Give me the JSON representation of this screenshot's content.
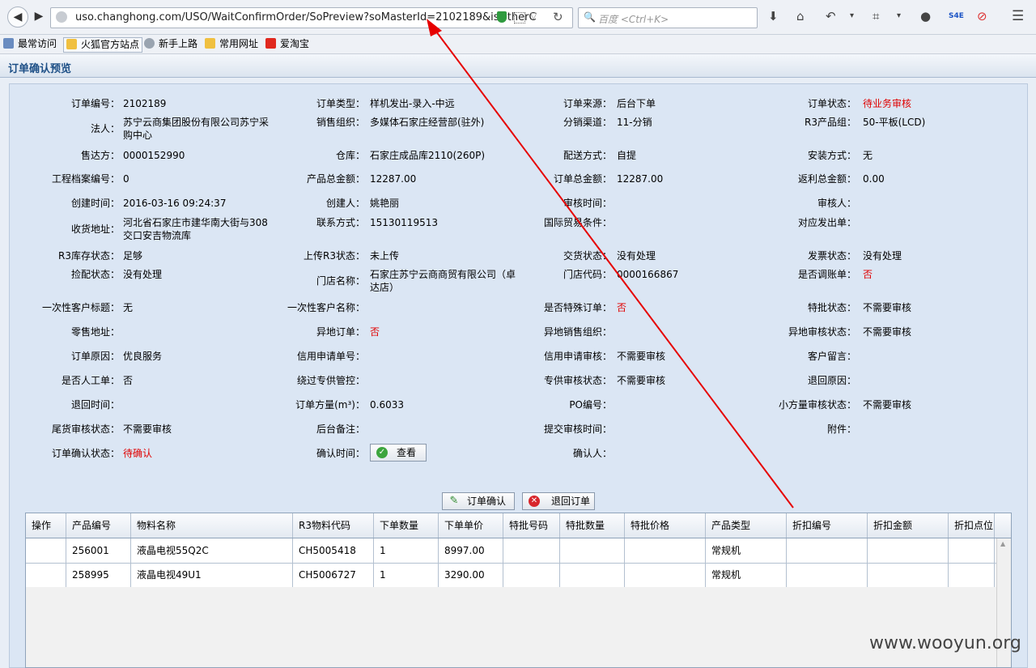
{
  "browser": {
    "url": "uso.changhong.com/USO/WaitConfirmOrder/SoPreview?soMasterId=2102189&isOtherC",
    "search_placeholder": "百度 <Ctrl+K>"
  },
  "bookmarks": [
    {
      "label": "最常访问"
    },
    {
      "label": "火狐官方站点"
    },
    {
      "label": "新手上路"
    },
    {
      "label": "常用网址"
    },
    {
      "label": "爱淘宝"
    }
  ],
  "page": {
    "title": "订单确认预览"
  },
  "fields": [
    {
      "label": "订单编号：",
      "value": "2102189"
    },
    {
      "label": "订单类型：",
      "value": "样机发出-录入-中远"
    },
    {
      "label": "订单来源：",
      "value": "后台下单"
    },
    {
      "label": "订单状态：",
      "value": "待业务审核"
    },
    {
      "label": "法人：",
      "value": "苏宁云商集团股份有限公司苏宁采购中心"
    },
    {
      "label": "销售组织：",
      "value": "多媒体石家庄经营部(驻外)"
    },
    {
      "label": "分销渠道：",
      "value": "11-分销"
    },
    {
      "label": "R3产品组：",
      "value": "50-平板(LCD)"
    },
    {
      "label": "售达方：",
      "value": "0000152990"
    },
    {
      "label": "仓库：",
      "value": "石家庄成品库2110(260P)"
    },
    {
      "label": "配送方式：",
      "value": "自提"
    },
    {
      "label": "安装方式：",
      "value": "无"
    },
    {
      "label": "工程档案编号：",
      "value": "0"
    },
    {
      "label": "产品总金额：",
      "value": "12287.00"
    },
    {
      "label": "订单总金额：",
      "value": "12287.00"
    },
    {
      "label": "返利总金额：",
      "value": "0.00"
    },
    {
      "label": "创建时间：",
      "value": "2016-03-16 09:24:37"
    },
    {
      "label": "创建人：",
      "value": "姚艳丽"
    },
    {
      "label": "审核时间：",
      "value": ""
    },
    {
      "label": "审核人：",
      "value": ""
    },
    {
      "label": "收货地址：",
      "value": "河北省石家庄市建华南大街与308交口安吉物流库"
    },
    {
      "label": "联系方式：",
      "value": "15130119513"
    },
    {
      "label": "国际贸易条件：",
      "value": ""
    },
    {
      "label": "对应发出单：",
      "value": ""
    },
    {
      "label": "R3库存状态：",
      "value": "足够"
    },
    {
      "label": "上传R3状态：",
      "value": "未上传"
    },
    {
      "label": "交货状态：",
      "value": "没有处理"
    },
    {
      "label": "发票状态：",
      "value": "没有处理"
    },
    {
      "label": "捡配状态：",
      "value": "没有处理"
    },
    {
      "label": "门店名称：",
      "value": "石家庄苏宁云商商贸有限公司（卓达店）"
    },
    {
      "label": "门店代码：",
      "value": "0000166867"
    },
    {
      "label": "是否调账单：",
      "value": "否"
    },
    {
      "label": "一次性客户标题：",
      "value": "无"
    },
    {
      "label": "一次性客户名称：",
      "value": ""
    },
    {
      "label": "是否特殊订单：",
      "value": "否"
    },
    {
      "label": "特批状态：",
      "value": "不需要审核"
    },
    {
      "label": "零售地址：",
      "value": ""
    },
    {
      "label": "异地订单：",
      "value": "否"
    },
    {
      "label": "异地销售组织：",
      "value": ""
    },
    {
      "label": "异地审核状态：",
      "value": "不需要审核"
    },
    {
      "label": "订单原因：",
      "value": "优良服务"
    },
    {
      "label": "信用申请单号：",
      "value": ""
    },
    {
      "label": "信用申请审核：",
      "value": "不需要审核"
    },
    {
      "label": "客户留言：",
      "value": ""
    },
    {
      "label": "是否人工单：",
      "value": "否"
    },
    {
      "label": "绕过专供管控：",
      "value": ""
    },
    {
      "label": "专供审核状态：",
      "value": "不需要审核"
    },
    {
      "label": "退回原因：",
      "value": ""
    },
    {
      "label": "退回时间：",
      "value": ""
    },
    {
      "label": "订单方量(m³)：",
      "value": "0.6033"
    },
    {
      "label": "PO编号：",
      "value": ""
    },
    {
      "label": "小方量审核状态：",
      "value": "不需要审核"
    },
    {
      "label": "尾货审核状态：",
      "value": "不需要审核"
    },
    {
      "label": "后台备注：",
      "value": ""
    },
    {
      "label": "提交审核时间：",
      "value": ""
    },
    {
      "label": "附件：",
      "value": ""
    },
    {
      "label": "订单确认状态：",
      "value": "待确认"
    },
    {
      "label": "确认时间：",
      "value": ""
    },
    {
      "label": "确认人：",
      "value": ""
    }
  ],
  "buttons": {
    "view": "查看",
    "confirm": "订单确认",
    "reject": "退回订单"
  },
  "grid": {
    "headers": [
      "操作",
      "产品编号",
      "物料名称",
      "R3物料代码",
      "下单数量",
      "下单单价",
      "特批号码",
      "特批数量",
      "特批价格",
      "产品类型",
      "折扣编号",
      "折扣金额",
      "折扣点位"
    ],
    "rows": [
      [
        "",
        "256001",
        "液晶电视55Q2C",
        "CH5005418",
        "1",
        "8997.00",
        "",
        "",
        "",
        "常规机",
        "",
        "",
        ""
      ],
      [
        "",
        "258995",
        "液晶电视49U1",
        "CH5006727",
        "1",
        "3290.00",
        "",
        "",
        "",
        "常规机",
        "",
        "",
        ""
      ]
    ]
  },
  "watermark": "www.wooyun.org",
  "colors": {
    "accent": "#1d4f86",
    "alert": "#e00000",
    "panel": "#dbe6f4",
    "arrow": "#e60000"
  }
}
